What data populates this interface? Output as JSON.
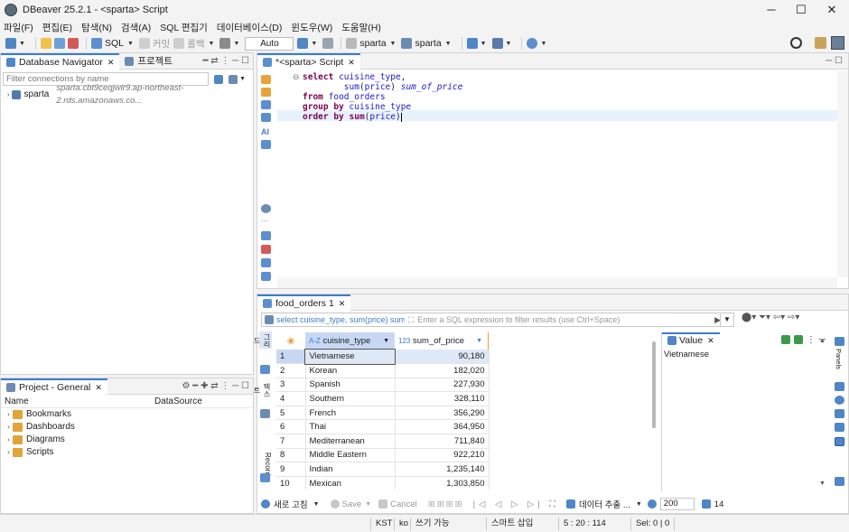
{
  "window": {
    "title": "DBeaver 25.2.1 - <sparta> Script",
    "minimize": "─",
    "maximize": "☐",
    "close": "✕"
  },
  "menu": [
    "파일(F)",
    "편집(E)",
    "탐색(N)",
    "검색(A)",
    "SQL 편집기",
    "데이터베이스(D)",
    "윈도우(W)",
    "도움말(H)"
  ],
  "toolbar": {
    "sql_label": "SQL",
    "commit_label": "커밋",
    "rollback_label": "롤백",
    "auto_label": "Auto",
    "connection": "sparta",
    "schema": "sparta"
  },
  "navigator": {
    "tab_label": "Database Navigator",
    "projects_tab_label": "프로젝트",
    "filter_placeholder": "Filter connections by name",
    "connection": {
      "name": "sparta",
      "host": "sparta.cbt9ceqjwlr9.ap-northeast-2.rds.amazonaws.co..."
    }
  },
  "project": {
    "tab_label": "Project - General",
    "col_name": "Name",
    "col_datasource": "DataSource",
    "items": [
      "Bookmarks",
      "Dashboards",
      "Diagrams",
      "Scripts"
    ]
  },
  "editor": {
    "tab_label": "*<sparta> Script",
    "lines": [
      [
        {
          "t": "kw",
          "v": "select"
        },
        {
          "t": "plain",
          "v": " "
        },
        {
          "t": "ident",
          "v": "cuisine_type"
        },
        {
          "t": "plain",
          "v": ","
        }
      ],
      [
        {
          "t": "plain",
          "v": "        "
        },
        {
          "t": "ident",
          "v": "sum"
        },
        {
          "t": "plain",
          "v": "("
        },
        {
          "t": "ident",
          "v": "price"
        },
        {
          "t": "plain",
          "v": ") "
        },
        {
          "t": "alias",
          "v": "sum_of_price"
        }
      ],
      [
        {
          "t": "kw",
          "v": "from"
        },
        {
          "t": "plain",
          "v": " "
        },
        {
          "t": "ident",
          "v": "food_orders"
        }
      ],
      [
        {
          "t": "kw",
          "v": "group by"
        },
        {
          "t": "plain",
          "v": " "
        },
        {
          "t": "ident",
          "v": "cuisine_type"
        }
      ],
      [
        {
          "t": "kw",
          "v": "order by"
        },
        {
          "t": "plain",
          "v": " "
        },
        {
          "t": "kw",
          "v": "sum"
        },
        {
          "t": "plain",
          "v": "("
        },
        {
          "t": "ident",
          "v": "price"
        },
        {
          "t": "plain",
          "v": ")"
        }
      ]
    ]
  },
  "results": {
    "tab_label": "food_orders 1",
    "query_preview": "select cuisine_type, sum(price) sum_c",
    "filter_placeholder": "Enter a SQL expression to filter results (use Ctrl+Space)",
    "columns": [
      {
        "type": "A-Z",
        "name": "cuisine_type"
      },
      {
        "type": "123",
        "name": "sum_of_price"
      }
    ],
    "rows": [
      {
        "n": "1",
        "type": "Vietnamese",
        "sum": "90,180"
      },
      {
        "n": "2",
        "type": "Korean",
        "sum": "182,020"
      },
      {
        "n": "3",
        "type": "Spanish",
        "sum": "227,930"
      },
      {
        "n": "4",
        "type": "Southern",
        "sum": "328,110"
      },
      {
        "n": "5",
        "type": "French",
        "sum": "356,290"
      },
      {
        "n": "6",
        "type": "Thai",
        "sum": "364,950"
      },
      {
        "n": "7",
        "type": "Mediterranean",
        "sum": "711,840"
      },
      {
        "n": "8",
        "type": "Middle Eastern",
        "sum": "922,210"
      },
      {
        "n": "9",
        "type": "Indian",
        "sum": "1,235,140"
      },
      {
        "n": "10",
        "type": "Mexican",
        "sum": "1,303,850"
      }
    ],
    "side_tabs": {
      "grid": "그리드",
      "text": "텍스트",
      "record": "Record"
    },
    "panels_label": "Panels",
    "value_panel": {
      "tab_label": "Value",
      "content": "Vietnamese"
    },
    "bottom": {
      "refresh": "새로 고침",
      "save": "Save",
      "cancel": "Cancel",
      "export": "데이터 추출 ...",
      "fetch_size": "200",
      "row_count": "14"
    }
  },
  "status": {
    "timezone": "KST",
    "locale": "ko",
    "mode": "쓰기 가능",
    "insert": "스마트 삽입",
    "position": "5 : 20 : 114",
    "selection": "Sel: 0 | 0"
  },
  "colors": {
    "accent": "#3c7bd4",
    "keyword": "#7f0055",
    "identifier": "#1a1ad0",
    "selected_row": "#dfe8f6",
    "header_highlight": "#c8d8f4"
  }
}
